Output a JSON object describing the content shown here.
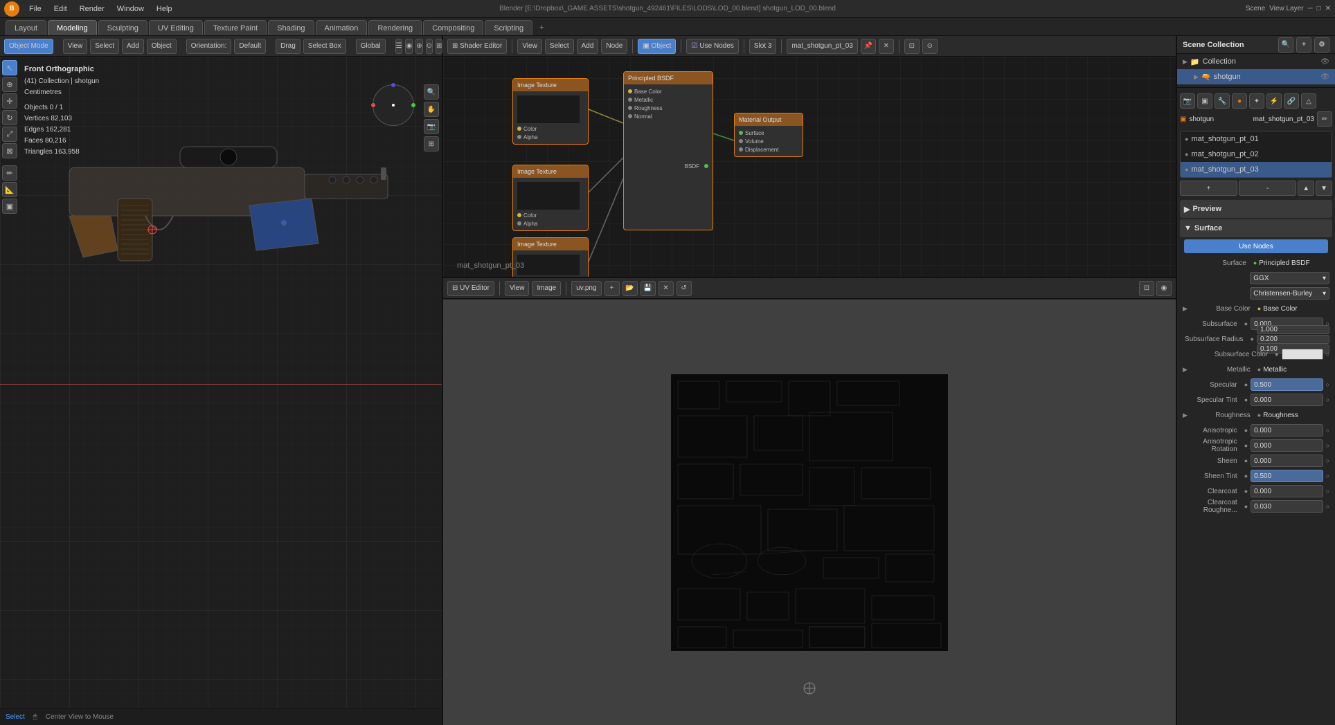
{
  "title": "Blender [E:\\Dropbox\\_GAME ASSETS\\shotgun_492461\\FILES\\LODS\\LOD_00.blend] shotgun_LOD_00.blend",
  "topMenu": {
    "logo": "B",
    "items": [
      "File",
      "Edit",
      "Render",
      "Window",
      "Help"
    ]
  },
  "workspaceTabs": {
    "tabs": [
      "Layout",
      "Modeling",
      "Sculpting",
      "UV Editing",
      "Texture Paint",
      "Shading",
      "Animation",
      "Rendering",
      "Compositing",
      "Scripting"
    ],
    "activeTab": "Modeling",
    "addLabel": "+",
    "sceneLabel": "Scene",
    "viewLayerLabel": "View Layer"
  },
  "viewport": {
    "mode": "Object Mode",
    "view": "View",
    "select": "Select",
    "add": "Add",
    "object": "Object",
    "orientation": "Orientation:",
    "orientationValue": "Default",
    "drag": "Drag",
    "selectBox": "Select Box",
    "transform": "Global",
    "viewLabel": "Front Orthographic",
    "collection": "(41) Collection | shotgun",
    "units": "Centimetres",
    "stats": {
      "objects": "Objects   0 / 1",
      "vertices": "Vertices   82,103",
      "edges": "Edges   162,281",
      "faces": "Faces   80,216",
      "triangles": "Triangles   163,958"
    }
  },
  "nodeEditor": {
    "editorLabel": "mat_shotgun_pt_03",
    "toolbar": {
      "editorType": "Shader Editor",
      "view": "View",
      "select": "Select",
      "add": "Add",
      "node": "Node",
      "useNodes": "Use Nodes",
      "slot": "Slot 3",
      "material": "mat_shotgun_pt_03"
    }
  },
  "uvEditor": {
    "toolbar": {
      "view": "View",
      "image": "Image",
      "imageName": "uv.png"
    }
  },
  "sceneCollection": {
    "title": "Scene Collection",
    "items": [
      {
        "label": "Collection",
        "level": 0,
        "icon": "▶"
      },
      {
        "label": "shotgun",
        "level": 1,
        "icon": "▶",
        "selected": true
      }
    ]
  },
  "materialPanel": {
    "materialList": [
      {
        "label": "mat_shotgun_pt_01"
      },
      {
        "label": "mat_shotgun_pt_02"
      },
      {
        "label": "mat_shotgun_pt_03",
        "selected": true
      }
    ],
    "materialName": "mat_shotgun_pt_03",
    "previewLabel": "Preview",
    "surfaceLabel": "Surface",
    "useNodesLabel": "Use Nodes",
    "surfaceType": "Principled BSDF",
    "ggxLabel": "GGX",
    "distributionLabel": "Christensen-Burley",
    "properties": [
      {
        "label": "Base Color",
        "dot": "yellow",
        "value": "Base Color",
        "type": "color-link"
      },
      {
        "label": "Subsurface",
        "dot": "gray",
        "value": "0.000",
        "type": "number"
      },
      {
        "label": "Subsurface Radius",
        "dot": "gray",
        "value1": "1.000",
        "value2": "0.200",
        "value3": "0.100",
        "type": "triple"
      },
      {
        "label": "Subsurface Color",
        "dot": "gray",
        "value": "",
        "type": "color-white"
      },
      {
        "label": "Metallic",
        "dot": "gray",
        "value": "Metallic",
        "type": "color-link"
      },
      {
        "label": "Specular",
        "dot": "gray",
        "value": "0.500",
        "type": "number",
        "highlighted": true
      },
      {
        "label": "Specular Tint",
        "dot": "gray",
        "value": "0.000",
        "type": "number"
      },
      {
        "label": "Roughness",
        "dot": "gray",
        "value": "Roughness",
        "type": "color-link"
      },
      {
        "label": "Anisotropic",
        "dot": "gray",
        "value": "0.000",
        "type": "number"
      },
      {
        "label": "Anisotropic Rotation",
        "dot": "gray",
        "value": "0.000",
        "type": "number"
      },
      {
        "label": "Sheen",
        "dot": "gray",
        "value": "0.000",
        "type": "number"
      },
      {
        "label": "Sheen Tint",
        "dot": "gray",
        "value": "0.500",
        "type": "number",
        "highlighted": true
      },
      {
        "label": "Clearcoat",
        "dot": "gray",
        "value": "0.000",
        "type": "number"
      },
      {
        "label": "Clearcoat Roughne...",
        "dot": "gray",
        "value": "0.030",
        "type": "number"
      }
    ]
  },
  "statusBar": {
    "selectLabel": "Select",
    "centerLabel": "Center View to Mouse"
  },
  "icons": {
    "arrow_right": "▶",
    "arrow_down": "▼",
    "close": "✕",
    "plus": "+",
    "gear": "⚙",
    "camera": "📷",
    "sphere": "◉",
    "material": "●",
    "object": "▣",
    "scene": "🎬",
    "world": "🌐",
    "render": "📷",
    "output": "📤",
    "view": "👁",
    "object_data": "△",
    "particles": "✦",
    "physics": "⚡",
    "constraints": "🔗",
    "modifier": "🔧",
    "chevron_down": "▾"
  }
}
